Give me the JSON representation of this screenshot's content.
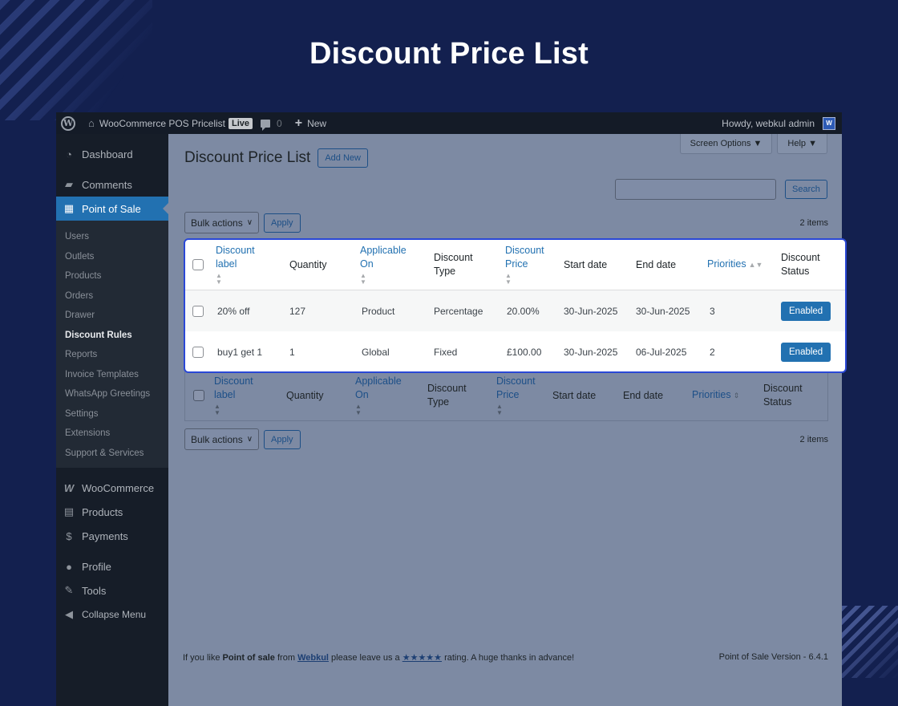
{
  "hero": {
    "title": "Discount Price List"
  },
  "adminbar": {
    "site_name": "WooCommerce POS Pricelist",
    "live_badge": "Live",
    "comments_count": "0",
    "new_label": "New",
    "howdy": "Howdy, webkul admin",
    "avatar_letter": "W"
  },
  "sidebar": {
    "top_items": [
      {
        "label": "Dashboard",
        "icon": "dashboard-icon"
      },
      {
        "label": "Comments",
        "icon": "comments-icon"
      },
      {
        "label": "Point of Sale",
        "icon": "calculator-icon"
      }
    ],
    "submenu": [
      "Users",
      "Outlets",
      "Products",
      "Orders",
      "Drawer",
      "Discount Rules",
      "Reports",
      "Invoice Templates",
      "WhatsApp Greetings",
      "Settings",
      "Extensions",
      "Support & Services"
    ],
    "current_submenu": "Discount Rules",
    "bottom_items": [
      {
        "label": "WooCommerce",
        "icon": "woocommerce-icon"
      },
      {
        "label": "Products",
        "icon": "archive-icon"
      },
      {
        "label": "Payments",
        "icon": "payments-icon"
      },
      {
        "label": "Profile",
        "icon": "user-icon"
      },
      {
        "label": "Tools",
        "icon": "wrench-icon"
      },
      {
        "label": "Collapse Menu",
        "icon": "collapse-icon"
      }
    ]
  },
  "toolbar": {
    "screen_options": "Screen Options ▼",
    "help": "Help ▼",
    "page_title": "Discount Price List",
    "add_new": "Add New",
    "search_button": "Search",
    "search_value": "",
    "bulk_actions": "Bulk actions",
    "apply": "Apply",
    "items_count": "2 items"
  },
  "table": {
    "columns": {
      "label": [
        "Discount",
        "label"
      ],
      "quantity": "Quantity",
      "applicable": [
        "Applicable",
        "On"
      ],
      "type": [
        "Discount",
        "Type"
      ],
      "price": [
        "Discount",
        "Price"
      ],
      "start": "Start date",
      "end": "End date",
      "priorities": "Priorities",
      "status": [
        "Discount",
        "Status"
      ]
    },
    "rows": [
      {
        "label": "20% off",
        "quantity": "127",
        "applicable": "Product",
        "type": "Percentage",
        "price": "20.00%",
        "start": "30-Jun-2025",
        "end": "30-Jun-2025",
        "priority": "3",
        "status": "Enabled"
      },
      {
        "label": "buy1 get 1",
        "quantity": "1",
        "applicable": "Global",
        "type": "Fixed",
        "price": "£100.00",
        "start": "30-Jun-2025",
        "end": "06-Jul-2025",
        "priority": "2",
        "status": "Enabled"
      }
    ]
  },
  "footer": {
    "pre": "If you like ",
    "product": "Point of sale",
    "mid": " from ",
    "brand": "Webkul",
    "mid2": " please leave us a ",
    "stars": "★★★★★",
    "post": " rating. A huge thanks in advance!",
    "version": "Point of Sale Version - 6.4.1"
  }
}
